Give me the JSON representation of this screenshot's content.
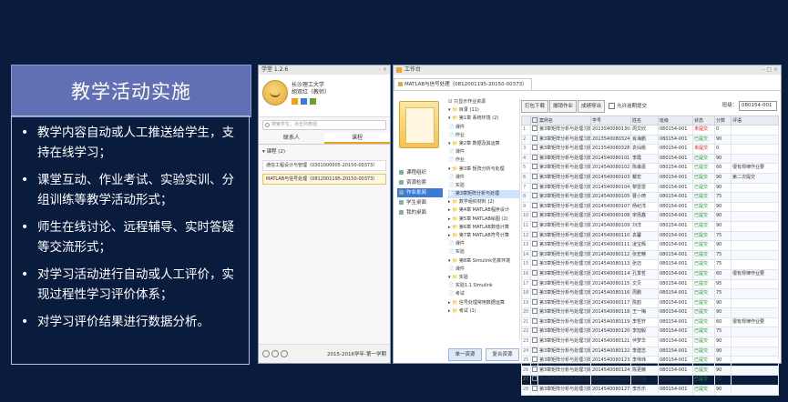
{
  "slide": {
    "title": "教学活动实施",
    "bullets": [
      "教学内容自动或人工推送给学生，支持在线学习；",
      "课堂互动、作业考试、实验实训、分组训练等教学活动形式；",
      "师生在线讨论、远程辅导、实时答疑等交流形式；",
      "对学习活动进行自动或人工评价，实现过程性学习评价体系；",
      "对学习评价结果进行数据分析。"
    ]
  },
  "left_app": {
    "window_title": "学堂 1.2.6",
    "school": "长沙理工大学",
    "user": "胡双红（教师）",
    "search_placeholder": "搜索学生，点击列表组",
    "tabs": [
      "联系人",
      "课程"
    ],
    "group": "▾ 课程 (2)",
    "courses": [
      "通信工程设计与管理（0301000005-20150-00373）",
      "MATLAB与信号处理（0812001195-20150-00373）"
    ],
    "term": "2015-2016学年-第一学期"
  },
  "right_app": {
    "window_title": "工作台",
    "course_tab": "MATLAB与信号处理（0812001195-20150-00373）",
    "nav": [
      "课程组织",
      "资源检索",
      "作业批阅",
      "学生桌面",
      "我的桌面"
    ],
    "only_show_label": "只显示作业资源",
    "tree": [
      "▾ 📁 目录 (11)",
      "  ▾ 📁 第1章 系统环境 (2)",
      "      📄 课件",
      "      📄 作业",
      "  ▾ 📁 第2章 数据及其运算",
      "      📄 课件",
      "      📄 作业",
      "  ▾ 📁 第3章 矩阵分析与处理",
      "      📄 课件",
      "      📄 实验",
      "      📄 第3章矩阵分析与处理",
      "  ▸ 📁 数学组织材料 (2)",
      "  ▸ 📁 第4章 MATLAB程序设计",
      "  ▸ 📁 第5章 MATLAB绘图 (2)",
      "  ▸ 📁 第6章 MATLAB数值计算",
      "  ▸ 📁 第7章 MATLAB符号计算",
      "      📄 课件",
      "      📄 实验",
      "  ▾ 📁 第8章 Simulink仿真环境",
      "      📄 课件",
      "    ▾ 📁 实验",
      "        📄 实验1.1 Simulink",
      "      📄 考试",
      "  ▸ 📁 信号处理常用数据运算",
      "  ▸ 📁 考试 (1)"
    ],
    "tree_buttons": [
      "单一资源",
      "复合资源"
    ],
    "toolbar": {
      "print": "打包下载",
      "undo": "撤销作业",
      "export": "成绩导出",
      "allow_late": "允许逾期提交",
      "class_label": "班级：",
      "class_value": "080154-001"
    },
    "columns": [
      "",
      "",
      "案例名",
      "学号",
      "姓名",
      "班级",
      "状态",
      "分数",
      "评语"
    ],
    "rows": [
      {
        "name": "第3章矩阵分析与处理习题1",
        "id": "2013540080130",
        "student": "周文欣",
        "cls": "080154-001",
        "status": "未提交",
        "score": "0",
        "comment": ""
      },
      {
        "name": "第3章矩阵分析与处理习题1",
        "id": "2013540080324",
        "student": "肖海鹏",
        "cls": "080154-001",
        "status": "已提交",
        "score": "90",
        "comment": ""
      },
      {
        "name": "第3章矩阵分析与处理习题1",
        "id": "2013540080328",
        "student": "袁仙桃",
        "cls": "080154-001",
        "status": "未提交",
        "score": "0",
        "comment": ""
      },
      {
        "name": "第3章矩阵分析与处理习题1",
        "id": "2014540080101",
        "student": "李霞",
        "cls": "080154-001",
        "status": "已提交",
        "score": "90",
        "comment": ""
      },
      {
        "name": "第3章矩阵分析与处理习题1",
        "id": "2014540080102",
        "student": "陈甫嘉",
        "cls": "080154-001",
        "status": "已提交",
        "score": "60",
        "comment": "很有规律作业要"
      },
      {
        "name": "第3章矩阵分析与处理习题1",
        "id": "2014540080103",
        "student": "戴宏",
        "cls": "080154-001",
        "status": "已提交",
        "score": "90",
        "comment": "第二次提交"
      },
      {
        "name": "第3章矩阵分析与处理习题1",
        "id": "2014540080104",
        "student": "黎雷雷",
        "cls": "080154-001",
        "status": "已提交",
        "score": "90",
        "comment": ""
      },
      {
        "name": "第3章矩阵分析与处理习题1",
        "id": "2014540080105",
        "student": "曹小琦",
        "cls": "080154-001",
        "status": "已提交",
        "score": "75",
        "comment": ""
      },
      {
        "name": "第3章矩阵分析与处理习题1",
        "id": "2014540080107",
        "student": "杨纪洋",
        "cls": "080154-001",
        "status": "已提交",
        "score": "90",
        "comment": ""
      },
      {
        "name": "第3章矩阵分析与处理习题1",
        "id": "2014540080108",
        "student": "宋扬鑫",
        "cls": "080154-001",
        "status": "已提交",
        "score": "90",
        "comment": ""
      },
      {
        "name": "第3章矩阵分析与处理习题1",
        "id": "2014540080109",
        "student": "刘洋",
        "cls": "080154-001",
        "status": "已提交",
        "score": "90",
        "comment": ""
      },
      {
        "name": "第3章矩阵分析与处理习题1",
        "id": "2014540080110",
        "student": "袁馨",
        "cls": "080154-001",
        "status": "已提交",
        "score": "75",
        "comment": ""
      },
      {
        "name": "第3章矩阵分析与处理习题1",
        "id": "2014540080111",
        "student": "凌宝辉",
        "cls": "080154-001",
        "status": "已提交",
        "score": "90",
        "comment": ""
      },
      {
        "name": "第3章矩阵分析与处理习题1",
        "id": "2014540080112",
        "student": "张宏精",
        "cls": "080154-001",
        "status": "已提交",
        "score": "75",
        "comment": ""
      },
      {
        "name": "第3章矩阵分析与处理习题1",
        "id": "2014540080113",
        "student": "张迈",
        "cls": "080154-001",
        "status": "已提交",
        "score": "75",
        "comment": ""
      },
      {
        "name": "第3章矩阵分析与处理习题1",
        "id": "2014540080114",
        "student": "孔季哲",
        "cls": "080154-001",
        "status": "已提交",
        "score": "60",
        "comment": "很有规律作业要"
      },
      {
        "name": "第3章矩阵分析与处理习题1",
        "id": "2014540080115",
        "student": "文贝",
        "cls": "080154-001",
        "status": "已提交",
        "score": "95",
        "comment": ""
      },
      {
        "name": "第3章矩阵分析与处理习题1",
        "id": "2014540080116",
        "student": "周鹏",
        "cls": "080154-001",
        "status": "已提交",
        "score": "75",
        "comment": ""
      },
      {
        "name": "第3章矩阵分析与处理习题1",
        "id": "2014540080117",
        "student": "陈韵",
        "cls": "080154-001",
        "status": "已提交",
        "score": "90",
        "comment": ""
      },
      {
        "name": "第3章矩阵分析与处理习题1",
        "id": "2014540080118",
        "student": "王一梅",
        "cls": "080154-001",
        "status": "已提交",
        "score": "90",
        "comment": ""
      },
      {
        "name": "第3章矩阵分析与处理习题1",
        "id": "2014540080119",
        "student": "李哲轩",
        "cls": "080154-001",
        "status": "已提交",
        "score": "60",
        "comment": "很有规律作业要"
      },
      {
        "name": "第3章矩阵分析与处理习题1",
        "id": "2014540080120",
        "student": "李旭毅",
        "cls": "080154-001",
        "status": "已提交",
        "score": "75",
        "comment": ""
      },
      {
        "name": "第3章矩阵分析与处理习题1",
        "id": "2014540080121",
        "student": "伴梦华",
        "cls": "080154-001",
        "status": "已提交",
        "score": "90",
        "comment": ""
      },
      {
        "name": "第3章矩阵分析与处理习题1",
        "id": "2014540080122",
        "student": "李建志",
        "cls": "080154-001",
        "status": "已提交",
        "score": "90",
        "comment": ""
      },
      {
        "name": "第3章矩阵分析与处理习题1",
        "id": "2014540080123",
        "student": "李伟玮",
        "cls": "080154-001",
        "status": "已提交",
        "score": "90",
        "comment": ""
      },
      {
        "name": "第3章矩阵分析与处理习题1",
        "id": "2014540080124",
        "student": "陈更薇",
        "cls": "080154-001",
        "status": "已提交",
        "score": "90",
        "comment": ""
      },
      {
        "name": "第3章矩阵分析与处理习题1",
        "id": "2014540080125",
        "student": "陆红珠",
        "cls": "080154-001",
        "status": "已提交",
        "score": "75",
        "comment": ""
      },
      {
        "name": "第3章矩阵分析与处理习题1",
        "id": "2014540080127",
        "student": "李乐乐",
        "cls": "080154-001",
        "status": "已提交",
        "score": "90",
        "comment": ""
      }
    ]
  },
  "colors": {
    "background": "#0a1c3e",
    "title_box": "#6170b4",
    "status_unsubmitted": "#e02020",
    "status_submitted": "#1a9a2a"
  }
}
